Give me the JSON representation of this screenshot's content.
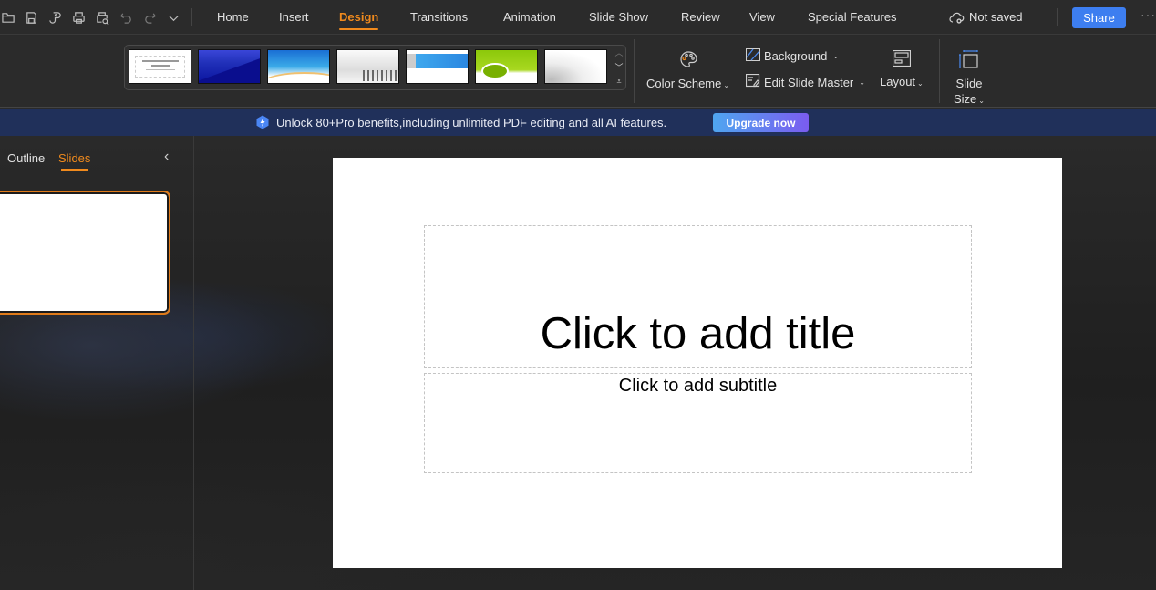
{
  "quick_access": [
    {
      "name": "open-icon"
    },
    {
      "name": "save-icon"
    },
    {
      "name": "format-painter-icon"
    },
    {
      "name": "print-icon"
    },
    {
      "name": "print-preview-icon"
    },
    {
      "name": "undo-icon"
    },
    {
      "name": "redo-icon"
    },
    {
      "name": "more-dropdown-icon"
    }
  ],
  "tabs": [
    {
      "label": "Home",
      "active": false
    },
    {
      "label": "Insert",
      "active": false
    },
    {
      "label": "Design",
      "active": true
    },
    {
      "label": "Transitions",
      "active": false
    },
    {
      "label": "Animation",
      "active": false
    },
    {
      "label": "Slide Show",
      "active": false
    },
    {
      "label": "Review",
      "active": false
    },
    {
      "label": "View",
      "active": false
    },
    {
      "label": "Special Features",
      "active": false
    }
  ],
  "status": {
    "save_state": "Not saved"
  },
  "share_label": "Share",
  "more_label": "···",
  "ribbon": {
    "themes": [
      {
        "name": "Office Theme (blank)"
      },
      {
        "name": "Blue Gradient"
      },
      {
        "name": "Blue Wave"
      },
      {
        "name": "Silhouettes"
      },
      {
        "name": "Blue Brush"
      },
      {
        "name": "Green Pie"
      },
      {
        "name": "Gears"
      }
    ],
    "color_scheme": "Color Scheme",
    "background": "Background",
    "edit_slide_master": "Edit Slide Master",
    "layout": "Layout",
    "slide_size_line1": "Slide",
    "slide_size_line2": "Size"
  },
  "banner": {
    "text": "Unlock 80+Pro benefits,including unlimited PDF editing and all AI features.",
    "button": "Upgrade now"
  },
  "panel": {
    "tabs": [
      {
        "label": "Outline",
        "active": false
      },
      {
        "label": "Slides",
        "active": true
      }
    ]
  },
  "slide": {
    "title_placeholder": "Click to add title",
    "subtitle_placeholder": "Click to add subtitle"
  },
  "colors": {
    "accent": "#f08a1d",
    "share": "#3d7ef0",
    "banner": "#20305a"
  }
}
